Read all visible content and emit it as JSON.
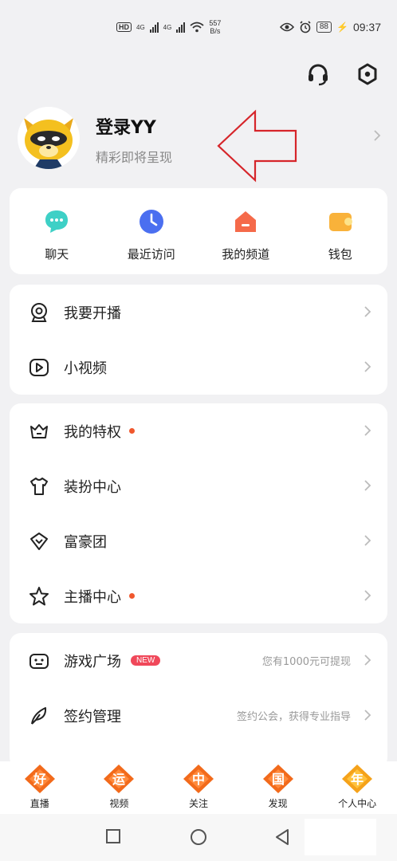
{
  "status_bar": {
    "hd": "HD",
    "sim1": "4G",
    "sim2": "4G",
    "speed_value": "557",
    "speed_unit": "B/s",
    "battery": "88",
    "time": "09:37"
  },
  "profile": {
    "title": "登录YY",
    "subtitle": "精彩即将呈现"
  },
  "quick_actions": [
    {
      "label": "聊天",
      "icon": "chat-bubble-icon",
      "color": "#3ed0c6"
    },
    {
      "label": "最近访问",
      "icon": "clock-icon",
      "color": "#4b6ff0"
    },
    {
      "label": "我的频道",
      "icon": "home-icon",
      "color": "#f56a4a"
    },
    {
      "label": "钱包",
      "icon": "wallet-icon",
      "color": "#f9b23a"
    }
  ],
  "group1": [
    {
      "label": "我要开播",
      "icon": "camera-icon"
    },
    {
      "label": "小视频",
      "icon": "video-play-icon"
    }
  ],
  "group2": [
    {
      "label": "我的特权",
      "icon": "crown-icon",
      "dot": true
    },
    {
      "label": "装扮中心",
      "icon": "tshirt-icon"
    },
    {
      "label": "富豪团",
      "icon": "diamond-icon"
    },
    {
      "label": "主播中心",
      "icon": "star-icon",
      "dot": true
    }
  ],
  "group3": [
    {
      "label": "游戏广场",
      "icon": "gamepad-icon",
      "badge": "NEW",
      "hint": "您有1000元可提现"
    },
    {
      "label": "签约管理",
      "icon": "feather-icon",
      "hint": "签约公会，获得专业指导"
    }
  ],
  "tabs": [
    {
      "label": "直播",
      "char": "好"
    },
    {
      "label": "视频",
      "char": "运"
    },
    {
      "label": "关注",
      "char": "中"
    },
    {
      "label": "发现",
      "char": "国"
    },
    {
      "label": "个人中心",
      "char": "年"
    }
  ],
  "colors": {
    "accent": "#f0572d",
    "tab_badge": "#f26a1b",
    "new_badge": "#f0485a"
  }
}
